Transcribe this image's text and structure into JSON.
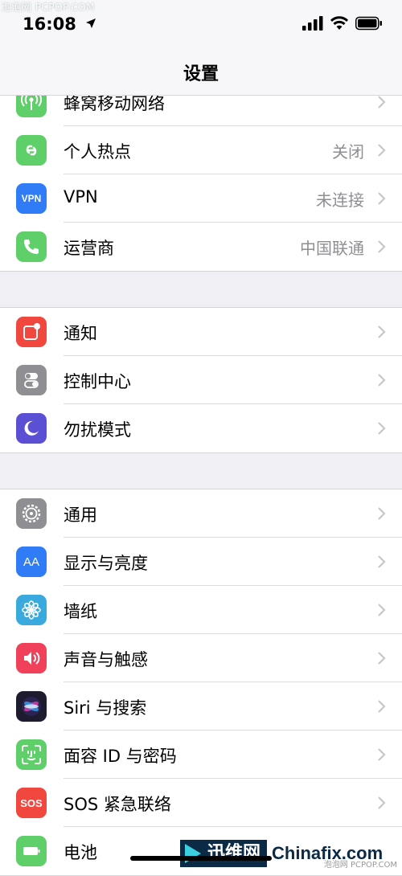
{
  "watermark_top": "泡泡网 PCPOP.COM",
  "status": {
    "time": "16:08"
  },
  "nav": {
    "title": "设置"
  },
  "groups": [
    {
      "items": [
        {
          "id": "cellular",
          "label": "蜂窝移动网络",
          "value": "",
          "icon": "antenna-icon",
          "color": "#5fcf6a"
        },
        {
          "id": "hotspot",
          "label": "个人热点",
          "value": "关闭",
          "icon": "link-icon",
          "color": "#5fcf6a"
        },
        {
          "id": "vpn",
          "label": "VPN",
          "value": "未连接",
          "icon": "vpn-icon",
          "icon_text": "VPN",
          "color": "#2f7cf6"
        },
        {
          "id": "carrier",
          "label": "运营商",
          "value": "中国联通",
          "icon": "phone-icon",
          "color": "#5fcf6a"
        }
      ]
    },
    {
      "items": [
        {
          "id": "notifications",
          "label": "通知",
          "value": "",
          "icon": "notification-icon",
          "color": "#f0483e"
        },
        {
          "id": "control-center",
          "label": "控制中心",
          "value": "",
          "icon": "toggles-icon",
          "color": "#8e8e93"
        },
        {
          "id": "dnd",
          "label": "勿扰模式",
          "value": "",
          "icon": "moon-icon",
          "color": "#5b4fd4"
        }
      ]
    },
    {
      "items": [
        {
          "id": "general",
          "label": "通用",
          "value": "",
          "icon": "gear-icon",
          "color": "#8e8e93"
        },
        {
          "id": "display",
          "label": "显示与亮度",
          "value": "",
          "icon": "text-size-icon",
          "icon_text": "AA",
          "color": "#2f7cf6"
        },
        {
          "id": "wallpaper",
          "label": "墙纸",
          "value": "",
          "icon": "flower-icon",
          "color": "#3aa9dd"
        },
        {
          "id": "sounds",
          "label": "声音与触感",
          "value": "",
          "icon": "speaker-icon",
          "color": "#f0405a"
        },
        {
          "id": "siri",
          "label": "Siri 与搜索",
          "value": "",
          "icon": "siri-icon",
          "color": "#1c1c2e"
        },
        {
          "id": "faceid",
          "label": "面容 ID 与密码",
          "value": "",
          "icon": "face-id-icon",
          "color": "#5fcf6a"
        },
        {
          "id": "sos",
          "label": "SOS 紧急联络",
          "value": "",
          "icon": "sos-icon",
          "icon_text": "SOS",
          "color": "#f0483e"
        },
        {
          "id": "battery",
          "label": "电池",
          "value": "",
          "icon": "battery-icon",
          "color": "#5fcf6a"
        }
      ]
    }
  ],
  "logo": {
    "part1": "迅维网",
    "part2": "Chinafix.com"
  },
  "watermark_bottom": "泡泡网 PCPOP.COM"
}
